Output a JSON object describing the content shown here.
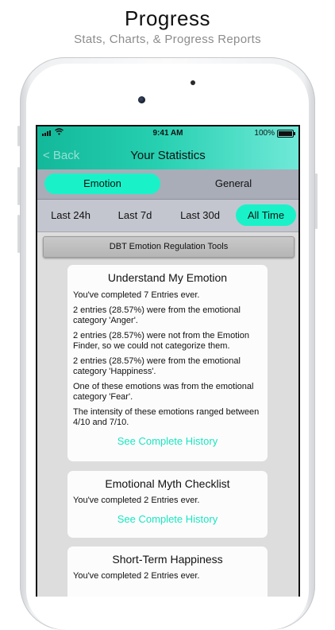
{
  "promo": {
    "title": "Progress",
    "subtitle": "Stats, Charts, & Progress Reports"
  },
  "status_bar": {
    "time": "9:41 AM",
    "battery": "100%"
  },
  "nav": {
    "back_label": "< Back",
    "title": "Your Statistics"
  },
  "segments": [
    {
      "label": "Emotion",
      "active": true
    },
    {
      "label": "General",
      "active": false
    }
  ],
  "ranges": [
    {
      "label": "Last 24h",
      "active": false
    },
    {
      "label": "Last 7d",
      "active": false
    },
    {
      "label": "Last 30d",
      "active": false
    },
    {
      "label": "All Time",
      "active": true
    }
  ],
  "section_header": "DBT Emotion Regulation Tools",
  "cards": [
    {
      "title": "Understand My Emotion",
      "lines": [
        "You've completed 7 Entries ever.",
        "2 entries (28.57%) were from the emotional category 'Anger'.",
        "2 entries (28.57%) were not from the Emotion Finder, so we could not categorize them.",
        "2 entries (28.57%) were from the emotional category 'Happiness'.",
        "One of these emotions was from the emotional category 'Fear'.",
        "The intensity of these emotions ranged between 4/10 and 7/10."
      ],
      "link": "See Complete History"
    },
    {
      "title": "Emotional Myth Checklist",
      "lines": [
        "You've completed 2 Entries ever."
      ],
      "link": "See Complete History"
    },
    {
      "title": "Short-Term Happiness",
      "lines": [
        "You've completed 2 Entries ever."
      ],
      "link": ""
    }
  ],
  "colors": {
    "accent": "#19f2c9",
    "link": "#19e6c1",
    "header_start": "#13b89a",
    "header_end": "#6fe9d8"
  }
}
